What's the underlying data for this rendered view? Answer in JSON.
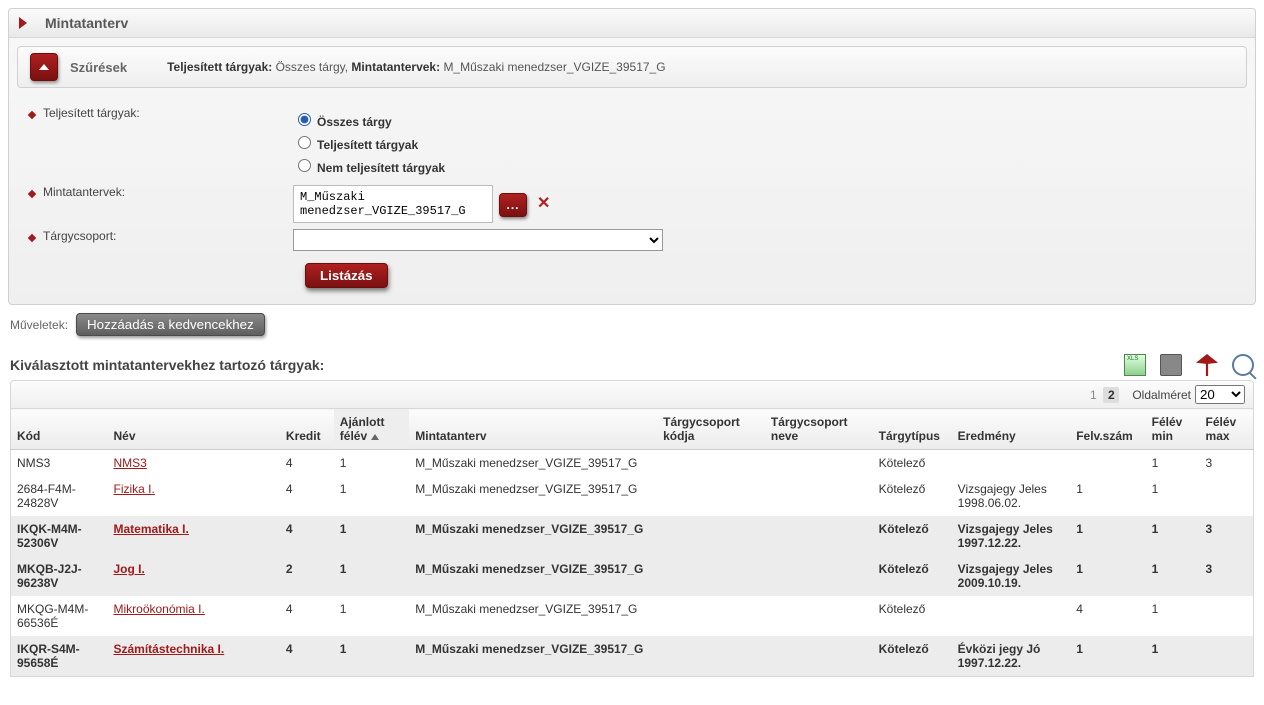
{
  "header": {
    "title": "Mintatanterv"
  },
  "filter": {
    "label": "Szűrések",
    "summary_prefix1": "Teljesített tárgyak:",
    "summary_val1": "Összes tárgy",
    "summary_prefix2": "Mintatantervek:",
    "summary_val2": "M_Műszaki menedzser_VGIZE_39517_G",
    "row1_label": "Teljesített tárgyak:",
    "radio_all": "Összes tárgy",
    "radio_done": "Teljesített tárgyak",
    "radio_notdone": "Nem teljesített tárgyak",
    "row2_label": "Mintatantervek:",
    "curriculum_value": "M_Műszaki menedzser_VGIZE_39517_G",
    "ellipsis": "...",
    "row3_label": "Tárgycsoport:",
    "list_btn": "Listázás"
  },
  "ops": {
    "label": "Műveletek:",
    "fav_btn": "Hozzáadás a kedvencekhez"
  },
  "section": {
    "title": "Kiválasztott mintatantervekhez tartozó tárgyak:"
  },
  "pager": {
    "p1": "1",
    "p2": "2",
    "size_label": "Oldalméret",
    "size_value": "20"
  },
  "cols": {
    "kod": "Kód",
    "nev": "Név",
    "kredit": "Kredit",
    "ajfel": "Ajánlott félév",
    "mt": "Mintatanterv",
    "tgk": "Tárgycsoport kódja",
    "tgn": "Tárgycsoport neve",
    "tt": "Tárgytípus",
    "er": "Eredmény",
    "fs": "Felv.szám",
    "fmin": "Félév min",
    "fmax": "Félév max"
  },
  "mt_name": "M_Műszaki menedzser_VGIZE_39517_G",
  "tt_mandatory": "Kötelező",
  "rows": [
    {
      "kod": "NMS3",
      "nev": "NMS3",
      "kr": "4",
      "af": "1",
      "er": "",
      "fs": "",
      "fmin": "1",
      "fmax": "3",
      "bold": false
    },
    {
      "kod": "2684-F4M-24828V",
      "nev": "Fizika I.",
      "kr": "4",
      "af": "1",
      "er": "Vizsgajegy Jeles 1998.06.02.",
      "fs": "1",
      "fmin": "1",
      "fmax": "",
      "bold": false
    },
    {
      "kod": "IKQK-M4M-52306V",
      "nev": "Matematika I.",
      "kr": "4",
      "af": "1",
      "er": "Vizsgajegy Jeles 1997.12.22.",
      "fs": "1",
      "fmin": "1",
      "fmax": "3",
      "bold": true
    },
    {
      "kod": "MKQB-J2J-96238V",
      "nev": "Jog I.",
      "kr": "2",
      "af": "1",
      "er": "Vizsgajegy Jeles 2009.10.19.",
      "fs": "1",
      "fmin": "1",
      "fmax": "3",
      "bold": true
    },
    {
      "kod": "MKQG-M4M-66536É",
      "nev": "Mikroökonómia I.",
      "kr": "4",
      "af": "1",
      "er": "",
      "fs": "4",
      "fmin": "1",
      "fmax": "",
      "bold": false
    },
    {
      "kod": "IKQR-S4M-95658É",
      "nev": "Számítástechnika I.",
      "kr": "4",
      "af": "1",
      "er": "Évközi jegy Jó 1997.12.22.",
      "fs": "1",
      "fmin": "1",
      "fmax": "",
      "bold": true
    }
  ]
}
